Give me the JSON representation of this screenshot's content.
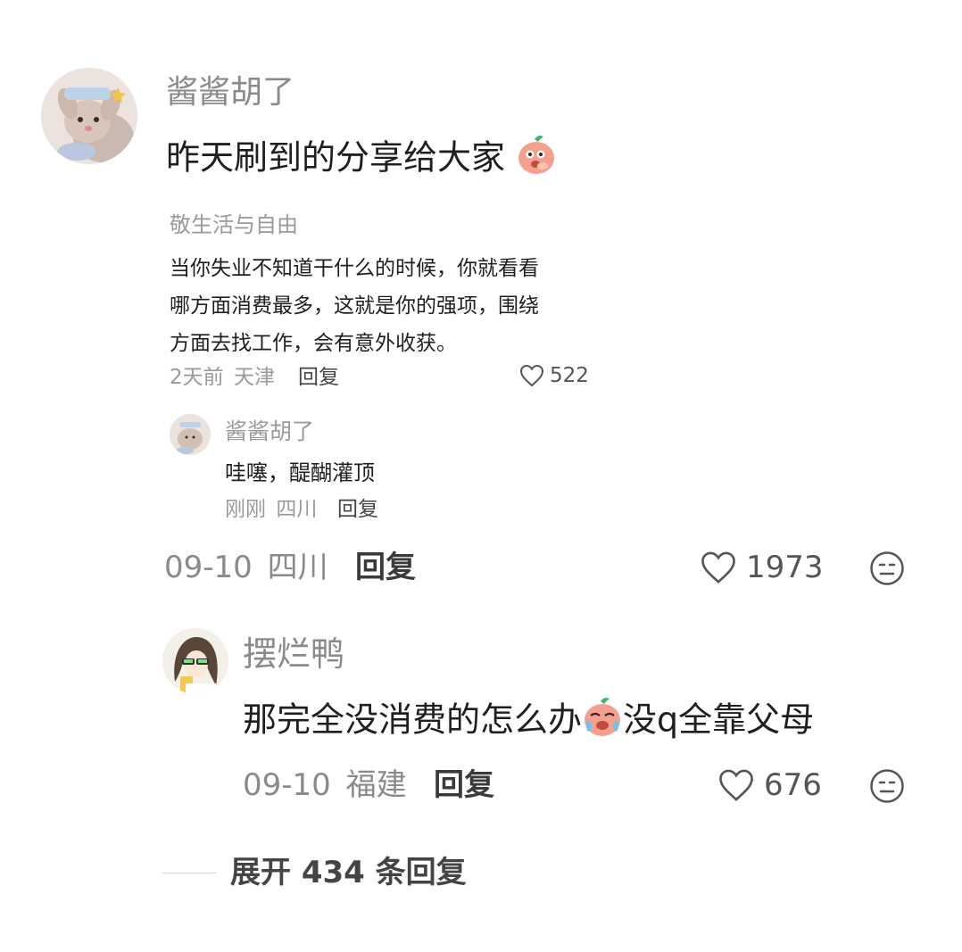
{
  "comment1": {
    "username": "酱酱胡了",
    "text": "昨天刷到的分享给大家",
    "emoji": "peach-blush-emoji",
    "quoted": {
      "username": "敬生活与自由",
      "lines": [
        "当你失业不知道干什么的时候，你就看看",
        "哪方面消费最多，这就是你的强项，围绕",
        "方面去找工作，会有意外收获。"
      ],
      "time": "2天前",
      "location": "天津",
      "reply_label": "回复",
      "likes": "522"
    },
    "inline_reply": {
      "username": "酱酱胡了",
      "text": "哇噻，醍醐灌顶",
      "time": "刚刚",
      "location": "四川",
      "reply_label": "回复"
    },
    "date": "09-10",
    "location": "四川",
    "reply_label": "回复",
    "likes": "1973"
  },
  "comment2": {
    "username": "摆烂鸭",
    "text_before": "那完全没消费的怎么办",
    "emoji": "peach-crying-emoji",
    "text_after": "没q全靠父母",
    "date": "09-10",
    "location": "福建",
    "reply_label": "回复",
    "likes": "676"
  },
  "expand": {
    "label": "展开 434 条回复"
  },
  "colors": {
    "muted": "#8a8a8a",
    "text": "#1f1f1f",
    "peach": "#f3a08c"
  }
}
